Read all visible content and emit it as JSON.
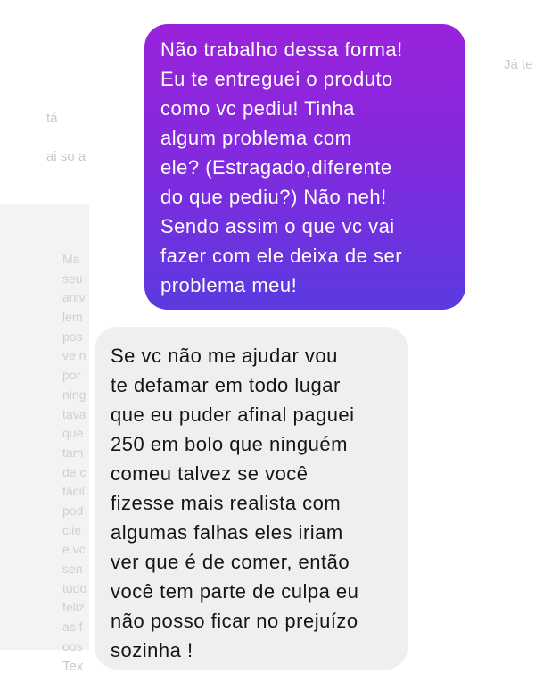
{
  "background_ghost": {
    "top_right": "Já te",
    "top_left_1": "tá",
    "top_left_2": "ai so a",
    "left_column": [
      "Ma",
      "seu",
      "aniv",
      "lem",
      "pos",
      "ve n",
      "por",
      "ning",
      "tava",
      "que",
      "tam",
      "de c",
      "fácil",
      "pod",
      "clie",
      "e vc",
      "sen",
      "tudo",
      "feliz",
      "as f",
      "oos"
    ],
    "bottom_left": "Tex"
  },
  "messages": [
    {
      "sender": "me",
      "lines": [
        "Não trabalho dessa forma!",
        "Eu te entreguei o produto",
        "como vc pediu! Tinha",
        "algum problema com",
        "ele? (Estragado,diferente",
        "do que pediu?) Não neh!",
        "Sendo assim o que vc vai",
        "fazer com ele deixa de ser",
        "problema meu!"
      ]
    },
    {
      "sender": "other",
      "lines": [
        "Se vc não me ajudar vou",
        "te defamar em todo lugar",
        "que eu puder afinal paguei",
        "250 em bolo que ninguém",
        "comeu talvez se você",
        "fizesse mais realista com",
        "algumas falhas eles iriam",
        "ver que é de comer, então",
        "você tem parte de culpa eu",
        "não posso ficar no prejuízo",
        "sozinha !"
      ]
    }
  ]
}
